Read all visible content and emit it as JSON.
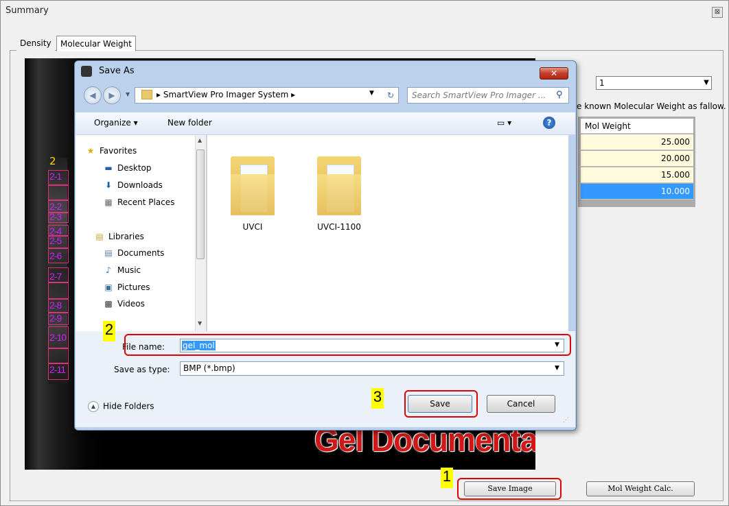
{
  "window": {
    "title": "Summary",
    "close_glyph": "⊠"
  },
  "tabs": [
    {
      "label": "Density"
    },
    {
      "label": "Molecular Weight"
    }
  ],
  "gel": {
    "lane_number": "2",
    "band_labels": [
      "2-1",
      "2-2",
      "2-3",
      "2-4",
      "2-5",
      "2-6",
      "2-7",
      "2-8",
      "2-9",
      "2-10",
      "2-11"
    ],
    "watermark": "Gel Documentation"
  },
  "right_panel": {
    "combo_value": "1",
    "instruction": "e known Molecular Weight as fallow.",
    "grid_header": "Mol Weight",
    "grid_rows": [
      "25.000",
      "20.000",
      "15.000",
      "10.000"
    ]
  },
  "buttons": {
    "save_image": "Save Image",
    "mol_weight_calc": "Mol Weight Calc."
  },
  "markers": [
    "1",
    "2",
    "3"
  ],
  "dialog": {
    "title": "Save As",
    "close_glyph": "✕",
    "address_path": "▸  SmartView Pro Imager System  ▸",
    "search_placeholder": "Search SmartView Pro Imager ...",
    "toolbar": {
      "organize": "Organize ▾",
      "new_folder": "New folder",
      "help": "?"
    },
    "nav": {
      "favorites": "Favorites",
      "favorites_items": [
        "Desktop",
        "Downloads",
        "Recent Places"
      ],
      "libraries": "Libraries",
      "libraries_items": [
        "Documents",
        "Music",
        "Pictures",
        "Videos"
      ]
    },
    "folders": [
      "UVCI",
      "UVCI-1100"
    ],
    "file_name_label": "File name:",
    "file_name_value": "gel_mol",
    "save_type_label": "Save as type:",
    "save_type_value": "BMP (*.bmp)",
    "hide_folders": "Hide Folders",
    "save_button": "Save",
    "cancel_button": "Cancel"
  }
}
